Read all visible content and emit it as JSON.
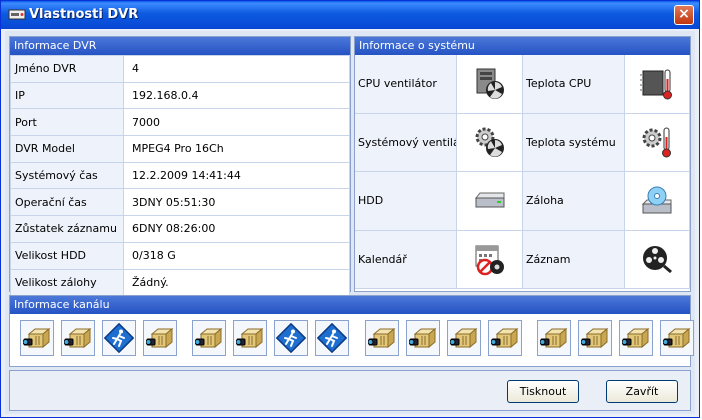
{
  "window": {
    "title": "Vlastnosti DVR",
    "close_label": "×"
  },
  "dvr_info": {
    "header": "Informace DVR",
    "rows": [
      {
        "key": "Jméno DVR",
        "value": "4"
      },
      {
        "key": "IP",
        "value": "192.168.0.4"
      },
      {
        "key": "Port",
        "value": "7000"
      },
      {
        "key": "DVR Model",
        "value": "MPEG4 Pro 16Ch"
      },
      {
        "key": "Systémový čas",
        "value": "12.2.2009 14:41:44"
      },
      {
        "key": "Operační čas",
        "value": "3DNY 05:51:30"
      },
      {
        "key": "Zůstatek záznamu",
        "value": "6DNY 08:26:00"
      },
      {
        "key": "Velikost HDD",
        "value": "0/318 G"
      },
      {
        "key": "Velikost zálohy",
        "value": "Žádný."
      }
    ]
  },
  "system_info": {
    "header": "Informace o systému",
    "items": [
      {
        "label": "CPU ventilátor",
        "icon": "cpu-fan-icon"
      },
      {
        "label": "Teplota CPU",
        "icon": "cpu-temperature-icon"
      },
      {
        "label": "Systémový ventilátor",
        "icon": "system-fan-icon"
      },
      {
        "label": "Teplota systému",
        "icon": "system-temperature-icon"
      },
      {
        "label": "HDD",
        "icon": "hdd-icon"
      },
      {
        "label": "Záloha",
        "icon": "backup-icon"
      },
      {
        "label": "Kalendář",
        "icon": "calendar-icon"
      },
      {
        "label": "Záznam",
        "icon": "recording-reel-icon"
      }
    ]
  },
  "channel_info": {
    "header": "Informace kanálu",
    "channels": [
      "camera",
      "camera",
      "motion",
      "camera",
      "camera",
      "camera",
      "motion",
      "motion",
      "camera",
      "camera",
      "camera",
      "camera",
      "camera",
      "camera",
      "camera",
      "camera"
    ]
  },
  "buttons": {
    "print": "Tisknout",
    "close": "Zavřít"
  },
  "colors": {
    "title_bar": "#0a5ae8",
    "panel_header": "#2553c4",
    "motion_channel": "#1f6fd1"
  }
}
